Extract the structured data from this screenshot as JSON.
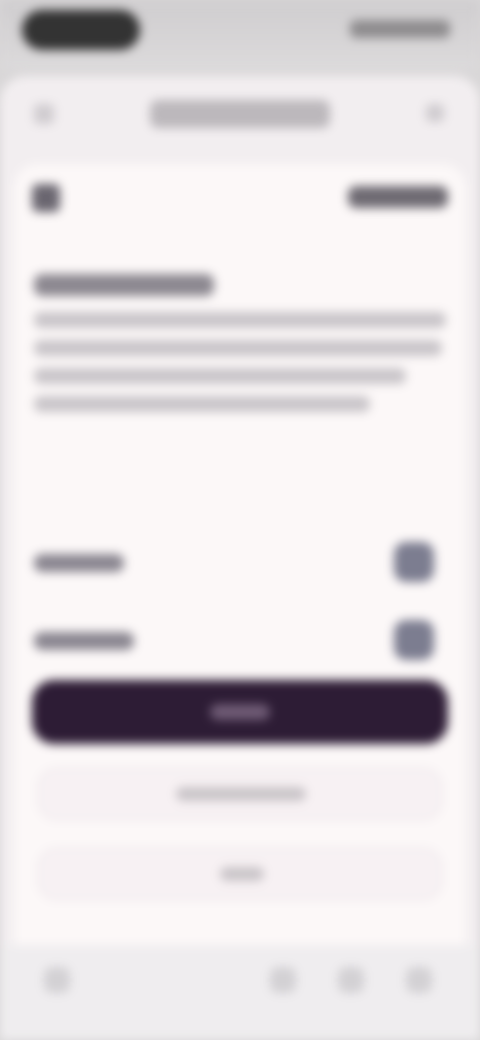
{
  "browser": {
    "url": "",
    "menu_label": ""
  },
  "dialog": {
    "header_link": "",
    "title": "",
    "body": "",
    "toggles": [
      {
        "label": "",
        "enabled": true
      },
      {
        "label": "",
        "enabled": true
      }
    ],
    "primary_button": "",
    "secondary_button": "",
    "tertiary_button": ""
  },
  "colors": {
    "primary_button": "#2d1c35",
    "dialog_background": "#fcf8f8",
    "toggle_accent": "#7c7d90"
  }
}
